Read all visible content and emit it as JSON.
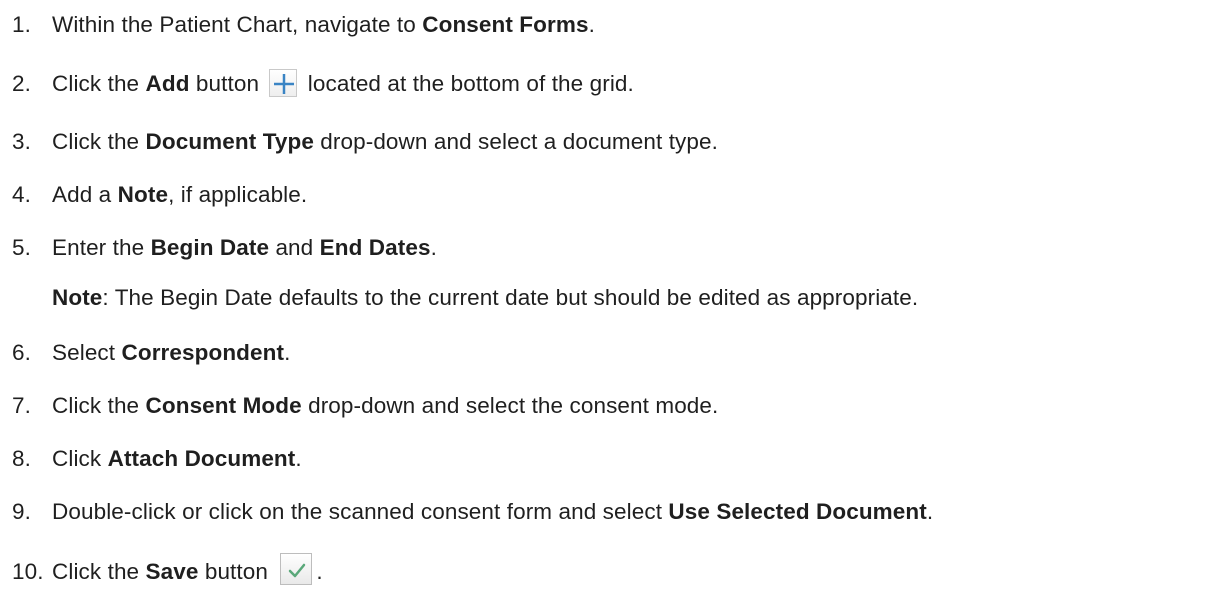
{
  "steps": [
    {
      "number": "1.",
      "before": "Within the Patient Chart, navigate to ",
      "bold": "Consent Forms",
      "after": "."
    },
    {
      "number": "2.",
      "before": "Click the ",
      "bold": "Add",
      "mid": " button ",
      "icon": "add-plus-icon",
      "after": " located at the bottom of the grid."
    },
    {
      "number": "3.",
      "before": "Click the ",
      "bold": "Document Type",
      "after": " drop-down and select a document type."
    },
    {
      "number": "4.",
      "before": "Add a ",
      "bold": "Note",
      "after": ", if applicable."
    },
    {
      "number": "5.",
      "before": "Enter the ",
      "bold": "Begin Date",
      "mid": " and ",
      "bold2": "End Dates",
      "after": "."
    },
    {
      "number": "6.",
      "before": "Select ",
      "bold": "Correspondent",
      "after": "."
    },
    {
      "number": "7.",
      "before": "Click the ",
      "bold": "Consent Mode",
      "after": " drop-down and select the consent mode."
    },
    {
      "number": "8.",
      "before": "Click ",
      "bold": "Attach Document",
      "after": "."
    },
    {
      "number": "9.",
      "before": "Double-click or click on the scanned consent form and select ",
      "bold": "Use Selected Document",
      "after": "."
    },
    {
      "number": "10.",
      "before": "Click the ",
      "bold": "Save",
      "mid": " button ",
      "icon": "save-check-icon",
      "after": "."
    }
  ],
  "note": {
    "label": "Note",
    "text": ": The Begin Date defaults to the current date but should be edited as appropriate."
  },
  "colors": {
    "text": "#1f1f1f",
    "add_icon": "#3a84c4",
    "save_icon": "#5aa87a"
  }
}
